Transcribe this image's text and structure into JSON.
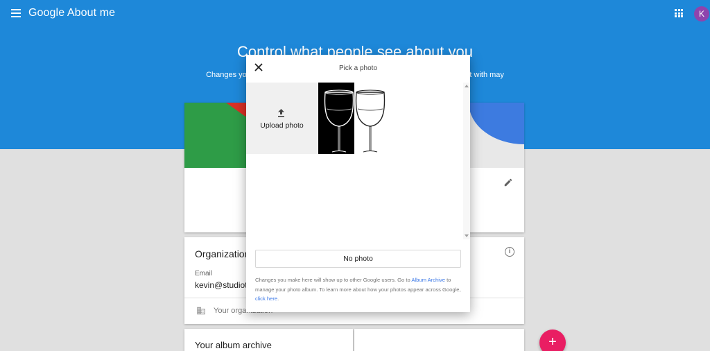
{
  "app": {
    "title": "Google About me",
    "avatar_letter": "K",
    "avatar_color": "#8e44ad",
    "brand_blue": "#1e88d9"
  },
  "hero": {
    "title": "Control what people see about you",
    "subtitle": "Changes you make here will show up to other Google users when they interact with may"
  },
  "profile_card": {
    "edit_icon": "pencil-icon"
  },
  "organizations": {
    "title": "Organizations",
    "email_label": "Email",
    "email_value": "kevin@studiotab",
    "org_placeholder": "Your organization"
  },
  "album": {
    "title": "Your album archive"
  },
  "fab": {
    "label": "+"
  },
  "dialog": {
    "title": "Pick a photo",
    "upload_label": "Upload photo",
    "no_photo_label": "No photo",
    "note_part1": "Changes you make here will show up to other Google users. Go to ",
    "note_link1": "Album Archive",
    "note_part2": " to manage your photo album. To learn more about how your photos appear across Google, ",
    "note_link2": "click here",
    "note_part3": "."
  }
}
